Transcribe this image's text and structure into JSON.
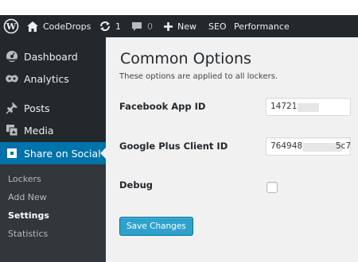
{
  "adminbar": {
    "site_name": "CodeDrops",
    "updates_count": "1",
    "comments_count": "0",
    "new_label": "New",
    "seo_label": "SEO",
    "performance_label": "Performance"
  },
  "sidebar": {
    "items": [
      {
        "label": "Dashboard",
        "icon": "dashboard-icon"
      },
      {
        "label": "Analytics",
        "icon": "analytics-icon"
      },
      {
        "label": "Posts",
        "icon": "pin-icon"
      },
      {
        "label": "Media",
        "icon": "media-icon"
      },
      {
        "label": "Share on Social",
        "icon": "share-icon",
        "active": true
      }
    ],
    "submenu": [
      {
        "label": "Lockers"
      },
      {
        "label": "Add New"
      },
      {
        "label": "Settings",
        "current": true
      },
      {
        "label": "Statistics"
      }
    ]
  },
  "main": {
    "title": "Common Options",
    "description": "These options are applied to all lockers.",
    "fields": {
      "facebook_app_id": {
        "label": "Facebook App ID",
        "value_visible": "14721"
      },
      "google_plus_client_id": {
        "label": "Google Plus Client ID",
        "value_visible_start": "764948",
        "value_visible_end": "5c7"
      },
      "debug": {
        "label": "Debug",
        "checked": false
      }
    },
    "save_label": "Save Changes"
  },
  "colors": {
    "adminbar_bg": "#23282d",
    "sidebar_bg": "#23282d",
    "submenu_bg": "#32373c",
    "active_menu": "#0073aa",
    "content_bg": "#f1f1f1",
    "primary_button": "#2ea2cc"
  }
}
